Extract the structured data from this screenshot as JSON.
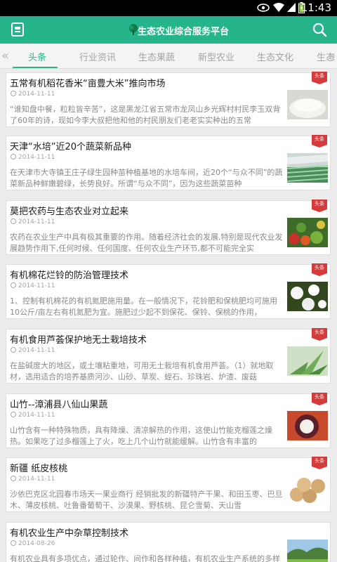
{
  "status_bar": {
    "time": "11:43"
  },
  "header": {
    "title": "生态农业综合服务平台"
  },
  "tabs": [
    {
      "label": "头条"
    },
    {
      "label": "行业资讯"
    },
    {
      "label": "生态果蔬"
    },
    {
      "label": "新型农业"
    },
    {
      "label": "生态文化"
    },
    {
      "label": "生态"
    }
  ],
  "nav_arrows": {
    "left": "«",
    "right": "»"
  },
  "badge_label": "头条",
  "articles": [
    {
      "title": "五常有机稻花香米“亩豊大米”推向市场",
      "date": "2014-11-11",
      "summary": "“谁知盘中餐，粒粒皆辛苦”，这是黑龙江省五常市龙凤山乡光辉村村民李玉双背了60年的诗，现如今李大叔把他和他的村民朋友们老老实实种出的五常",
      "thumb_icon": "rice-image"
    },
    {
      "title": "天津“水培”近20个蔬菜新品种",
      "date": "2014-11-11",
      "summary": "在天津市大寺镇王庄子绿生园种苗种植基地的水培车间，近20个“与众不同”的蔬菜新品种鲜嫩碧绿，长势良好。所谓“与众不同”，因为这些蔬菜苗种",
      "thumb_icon": "greenhouse-image"
    },
    {
      "title": "莫把农药与生态农业对立起来",
      "date": "2014-11-11",
      "summary": "农药在农业生产中具有极其重要的作用。随着经济社会的发展,特别是现代农业发展趋势作用下,任何时候、任何国度、任何农业生产环节,都不可能完全实",
      "thumb_icon": "vegetables-image"
    },
    {
      "title": "有机棉花烂铃的防治管理技术",
      "date": "2014-11-11",
      "summary": "1、控制有机棉花的有机氮肥施用量。在一般情况下，花铃肥和保桃肥均可施用10公斤/亩左右有机氮肥为宜。施肥过少起不到保花、保铃、保桃的作用，",
      "thumb_icon": "cotton-image"
    },
    {
      "title": "有机食用芦荟保护地无土栽培技术",
      "date": "2014-11-11",
      "summary": "在盐碱度大的地区，或土壤粘重地，可用无土栽培有机食用芦荟。（1）就地取材，选用适合的培养基质河沙、山砂、草炭、蛭石、珍珠岩、炉渣、废菇",
      "thumb_icon": "aloe-image"
    },
    {
      "title": "山竹--漳浦县八仙山果蔬",
      "date": "2014-11-11",
      "summary": "山竹含有一种特殊物质，具有降燥、清凉解热的作用，这使山竹能克榴莲之燥热。如果吃了过多榴莲上了火，吃上几个山竹就能缓解。山竹含有丰富的",
      "thumb_icon": "mangosteen-image"
    },
    {
      "title": "新疆 纸皮核桃",
      "date": "2014-11-11",
      "summary": "沙依巴克区北园春市场天一果业商行 经销批发的新疆特产干果、和田玉枣、巴旦木、薄皮核桃、吐鲁番葡萄干、沙漠果、野核桃、昆仑雪菊、天山雪",
      "thumb_icon": "walnut-image"
    },
    {
      "title": "有机农业生产中杂草控制技术",
      "date": "2014-08-26",
      "summary": "有机农业具有多项优点，通过轮作、间作和各样种植，有机农业生产系统的多样",
      "thumb_icon": "field-image"
    }
  ]
}
